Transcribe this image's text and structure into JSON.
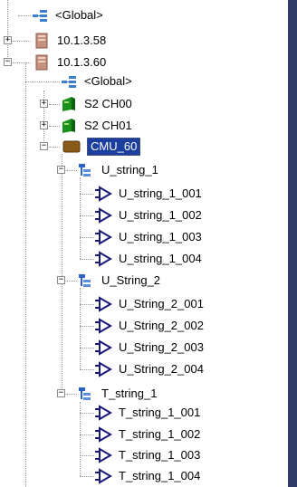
{
  "tree": {
    "global_top": "<Global>",
    "host1": "10.1.3.58",
    "host2": "10.1.3.60",
    "global_child": "<Global>",
    "s2ch00": "S2 CH00",
    "s2ch01": "S2 CH01",
    "cmu": "CMU_60",
    "groups": [
      {
        "name": "U_string_1",
        "items": [
          "U_string_1_001",
          "U_string_1_002",
          "U_string_1_003",
          "U_string_1_004"
        ]
      },
      {
        "name": "U_String_2",
        "items": [
          "U_String_2_001",
          "U_String_2_002",
          "U_String_2_003",
          "U_String_2_004"
        ]
      },
      {
        "name": "T_string_1",
        "items": [
          "T_string_1_001",
          "T_string_1_002",
          "T_string_1_003",
          "T_string_1_004"
        ]
      }
    ]
  },
  "colors": {
    "selection": "#1c3f9e",
    "sidebar": "#2f3a66"
  },
  "icons": {
    "global": "network-icon",
    "host": "server-icon",
    "channel": "card-icon",
    "cmu": "module-icon",
    "group": "string-group-icon",
    "item": "signal-icon"
  }
}
